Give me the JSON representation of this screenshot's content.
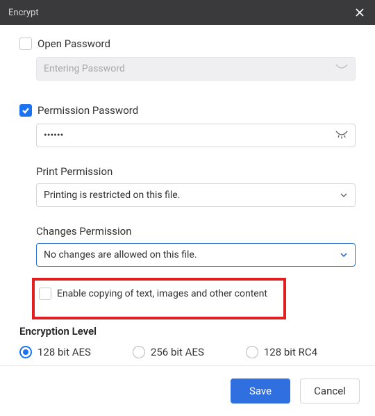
{
  "titlebar": {
    "title": "Encrypt"
  },
  "open_password": {
    "label": "Open Password",
    "checked": false,
    "placeholder": "Entering Password",
    "value": ""
  },
  "permission_password": {
    "label": "Permission Password",
    "checked": true,
    "value": "••••••"
  },
  "print_permission": {
    "title": "Print Permission",
    "selected": "Printing is restricted on this file."
  },
  "changes_permission": {
    "title": "Changes Permission",
    "selected": "No changes are allowed on this file."
  },
  "enable_copy": {
    "label": "Enable copying of text, images and other content",
    "checked": false
  },
  "encryption": {
    "title": "Encryption Level",
    "options": {
      "aes128": "128 bit AES",
      "aes256": "256 bit AES",
      "rc4128": "128 bit RC4"
    },
    "selected": "aes128"
  },
  "footer": {
    "save": "Save",
    "cancel": "Cancel"
  }
}
